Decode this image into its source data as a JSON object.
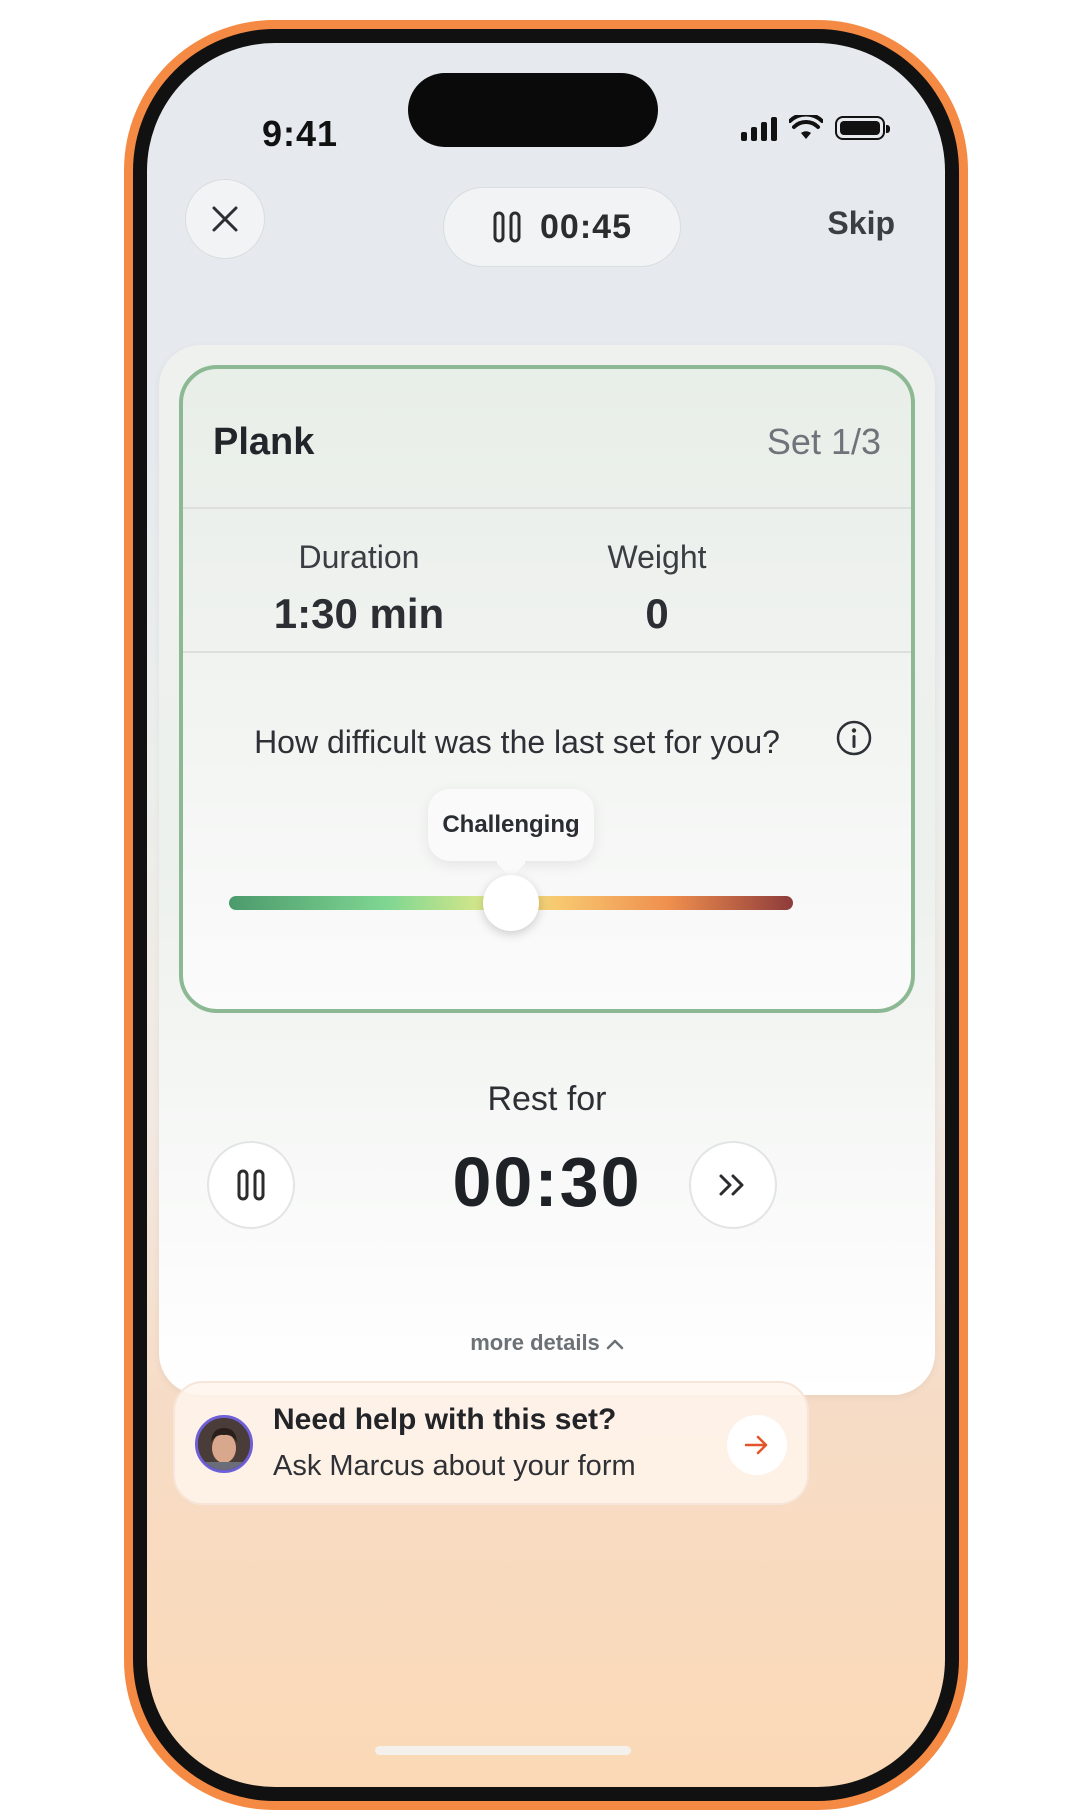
{
  "status_bar": {
    "time": "9:41"
  },
  "header": {
    "timer": "00:45",
    "skip_label": "Skip"
  },
  "exercise": {
    "name": "Plank",
    "set_label": "Set 1/3",
    "duration_label": "Duration",
    "duration_value": "1:30 min",
    "weight_label": "Weight",
    "weight_value": "0"
  },
  "difficulty": {
    "question": "How difficult was the last set for you?",
    "selected_label": "Challenging",
    "slider_position": 0.5,
    "gradient_colors": [
      "#4c9a6c",
      "#7fd692",
      "#d6e78a",
      "#f7c970",
      "#ef8f4e",
      "#8e3b3b"
    ]
  },
  "rest": {
    "label": "Rest for",
    "timer": "00:30"
  },
  "more_details": {
    "label": "more details"
  },
  "help": {
    "title": "Need help with this set?",
    "subtitle": "Ask Marcus about your form"
  },
  "colors": {
    "device_frame": "#f58a45",
    "card_border": "#8cb893",
    "arrow_accent": "#e2552a"
  }
}
